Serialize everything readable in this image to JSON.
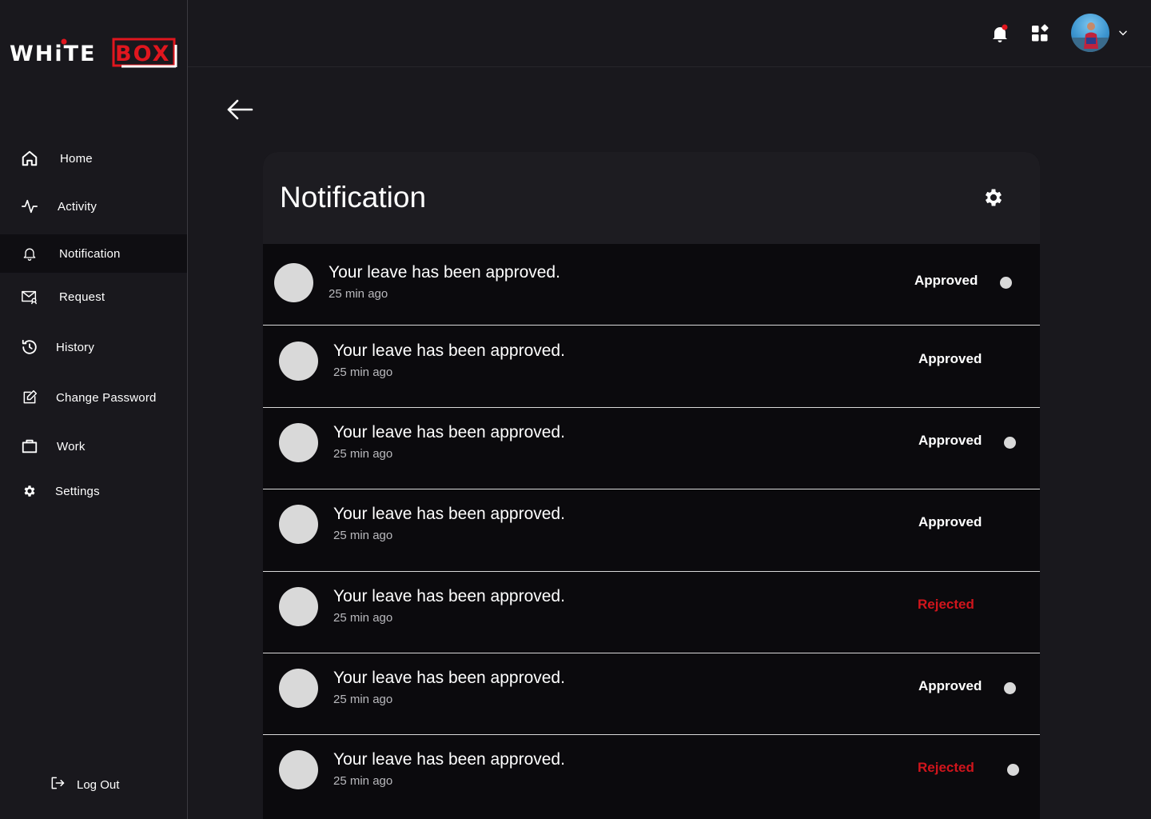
{
  "brand": {
    "logo_text_white": "WHiTE",
    "logo_text_red": "BOX"
  },
  "sidebar": {
    "items": [
      {
        "id": "home",
        "label": "Home",
        "icon": "home-icon"
      },
      {
        "id": "activity",
        "label": "Activity",
        "icon": "activity-icon"
      },
      {
        "id": "notification",
        "label": "Notification",
        "icon": "bell-icon",
        "active": true
      },
      {
        "id": "request",
        "label": "Request",
        "icon": "mail-user-icon"
      },
      {
        "id": "history",
        "label": "History",
        "icon": "history-icon"
      },
      {
        "id": "change-password",
        "label": "Change Password",
        "icon": "edit-icon"
      },
      {
        "id": "work",
        "label": "Work",
        "icon": "briefcase-icon"
      },
      {
        "id": "settings",
        "label": "Settings",
        "icon": "gear-icon"
      }
    ],
    "logout_label": "Log Out"
  },
  "topbar": {
    "bell_icon": "bell-icon",
    "apps_icon": "apps-grid-icon",
    "avatar_icon": "avatar",
    "dropdown_icon": "chevron-down-icon",
    "notification_badge_color": "#e0161e"
  },
  "main": {
    "back_icon": "arrow-left-icon",
    "title": "Notification",
    "settings_icon": "gear-icon",
    "notifications": [
      {
        "message": "Your leave has been approved.",
        "time": "25 min ago",
        "status": "Approved",
        "unread": true
      },
      {
        "message": "Your leave has been approved.",
        "time": "25 min ago",
        "status": "Approved",
        "unread": false
      },
      {
        "message": "Your leave has been approved.",
        "time": "25 min ago",
        "status": "Approved",
        "unread": true
      },
      {
        "message": "Your leave has been approved.",
        "time": "25 min ago",
        "status": "Approved",
        "unread": false
      },
      {
        "message": "Your leave has been approved.",
        "time": "25 min ago",
        "status": "Rejected",
        "unread": false
      },
      {
        "message": "Your leave has been approved.",
        "time": "25 min ago",
        "status": "Approved",
        "unread": true
      },
      {
        "message": "Your leave has been approved.",
        "time": "25 min ago",
        "status": "Rejected",
        "unread": true
      }
    ]
  },
  "colors": {
    "accent_red": "#d0151c",
    "background": "#19181d",
    "panel": "#0b0a0d"
  }
}
